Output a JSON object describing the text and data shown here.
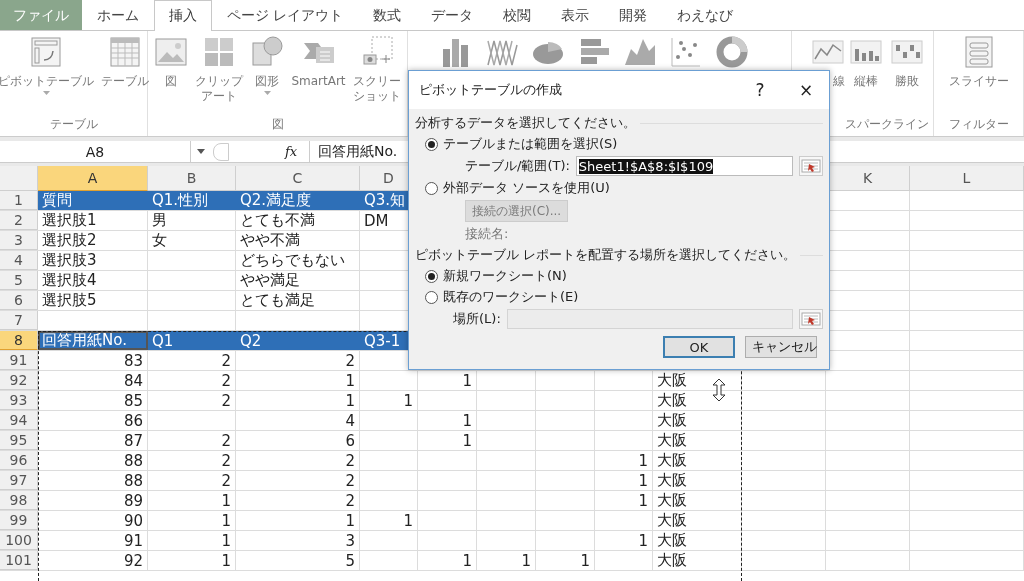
{
  "ribbon_tabs": [
    {
      "label": "ファイル",
      "kind": "file",
      "selected": false
    },
    {
      "label": "ホーム",
      "kind": "tab",
      "selected": false
    },
    {
      "label": "挿入",
      "kind": "tab",
      "selected": true
    },
    {
      "label": "ページ レイアウト",
      "kind": "tab",
      "selected": false
    },
    {
      "label": "数式",
      "kind": "tab",
      "selected": false
    },
    {
      "label": "データ",
      "kind": "tab",
      "selected": false
    },
    {
      "label": "校閲",
      "kind": "tab",
      "selected": false
    },
    {
      "label": "表示",
      "kind": "tab",
      "selected": false
    },
    {
      "label": "開発",
      "kind": "tab",
      "selected": false
    },
    {
      "label": "わえなび",
      "kind": "tab",
      "selected": false
    }
  ],
  "ribbon_groups": [
    {
      "kind": "commands",
      "label": "テーブル",
      "commands": [
        {
          "label": [
            "ピボットテーブル"
          ],
          "dropdown": true
        },
        {
          "label": [
            "テーブル"
          ],
          "dropdown": false
        }
      ]
    },
    {
      "kind": "commands",
      "label": "図",
      "commands": [
        {
          "label": [
            "図"
          ],
          "dropdown": false
        },
        {
          "label": [
            "クリップ",
            "アート"
          ],
          "dropdown": false
        },
        {
          "label": [
            "図形"
          ],
          "dropdown": true
        },
        {
          "label": [
            "SmartArt"
          ],
          "dropdown": false
        },
        {
          "label": [
            "スクリー",
            "ショット"
          ],
          "dropdown": false
        }
      ]
    },
    {
      "kind": "charts"
    },
    {
      "kind": "commands",
      "label": "スパークライン",
      "commands": [
        {
          "label": [
            "線"
          ],
          "dropdown": false
        },
        {
          "label": [
            "縦棒"
          ],
          "dropdown": false
        },
        {
          "label": [
            "勝敗"
          ],
          "dropdown": false
        }
      ]
    },
    {
      "kind": "commands",
      "label": "フィルター",
      "commands": [
        {
          "label": [
            "スライサー"
          ],
          "dropdown": false
        }
      ]
    }
  ],
  "formula_bar": {
    "name_box": "A8",
    "function_label": "fx",
    "formula": "回答用紙No."
  },
  "sheet": {
    "columns": [
      {
        "label": "A",
        "selected": true,
        "kind": "number"
      },
      {
        "label": "B",
        "selected": false,
        "kind": "number"
      },
      {
        "label": "C",
        "selected": false,
        "kind": "number"
      },
      {
        "label": "D",
        "selected": false,
        "kind": "number"
      },
      {
        "kind": "number"
      },
      {
        "kind": "number"
      },
      {
        "kind": "number"
      },
      {
        "kind": "number"
      },
      {
        "kind": "text"
      },
      {
        "kind": "number"
      },
      {
        "label": "K",
        "selected": false,
        "kind": "number"
      },
      {
        "label": "L",
        "selected": false,
        "kind": "number"
      }
    ],
    "rows": [
      {
        "number": "1",
        "kind": "header",
        "selected": false,
        "cells": [
          "質問",
          "Q1.性別",
          "Q2.満足度",
          "Q3.知"
        ]
      },
      {
        "number": "2",
        "kind": "text",
        "selected": false,
        "cells": [
          "選択肢1",
          "男",
          "とても不満",
          "DM"
        ]
      },
      {
        "number": "3",
        "kind": "text",
        "selected": false,
        "cells": [
          "選択肢2",
          "女",
          "やや不満"
        ]
      },
      {
        "number": "4",
        "kind": "text",
        "selected": false,
        "cells": [
          "選択肢3",
          null,
          "どちらでもない"
        ]
      },
      {
        "number": "5",
        "kind": "text",
        "selected": false,
        "cells": [
          "選択肢4",
          null,
          "やや満足"
        ]
      },
      {
        "number": "6",
        "kind": "text",
        "selected": false,
        "cells": [
          "選択肢5",
          null,
          "とても満足"
        ]
      },
      {
        "number": "7",
        "kind": "text",
        "selected": false
      },
      {
        "number": "8",
        "kind": "header",
        "selected": true,
        "cells": [
          "回答用紙No.",
          "Q1",
          "Q2",
          "Q3-1"
        ]
      },
      {
        "number": "91",
        "kind": "data",
        "selected": false,
        "cells": [
          "83",
          "2",
          "2"
        ]
      },
      {
        "number": "92",
        "kind": "data",
        "selected": false,
        "cells": [
          "84",
          "2",
          "1",
          null,
          "1",
          null,
          null,
          null,
          "大阪"
        ]
      },
      {
        "number": "93",
        "kind": "data",
        "selected": false,
        "cells": [
          "85",
          "2",
          "1",
          "1",
          null,
          null,
          null,
          null,
          "大阪"
        ]
      },
      {
        "number": "94",
        "kind": "data",
        "selected": false,
        "cells": [
          "86",
          null,
          "4",
          null,
          "1",
          null,
          null,
          null,
          "大阪"
        ]
      },
      {
        "number": "95",
        "kind": "data",
        "selected": false,
        "cells": [
          "87",
          "2",
          "6",
          null,
          "1",
          null,
          null,
          null,
          "大阪"
        ]
      },
      {
        "number": "96",
        "kind": "data",
        "selected": false,
        "cells": [
          "88",
          "2",
          "2",
          null,
          null,
          null,
          null,
          "1",
          "大阪"
        ]
      },
      {
        "number": "97",
        "kind": "data",
        "selected": false,
        "cells": [
          "88",
          "2",
          "2",
          null,
          null,
          null,
          null,
          "1",
          "大阪"
        ]
      },
      {
        "number": "98",
        "kind": "data",
        "selected": false,
        "cells": [
          "89",
          "1",
          "2",
          null,
          null,
          null,
          null,
          "1",
          "大阪"
        ]
      },
      {
        "number": "99",
        "kind": "data",
        "selected": false,
        "cells": [
          "90",
          "1",
          "1",
          "1",
          null,
          null,
          null,
          null,
          "大阪"
        ]
      },
      {
        "number": "100",
        "kind": "data",
        "selected": false,
        "cells": [
          "91",
          "1",
          "3",
          null,
          null,
          null,
          null,
          "1",
          "大阪"
        ]
      },
      {
        "number": "101",
        "kind": "data",
        "selected": false,
        "cells": [
          "92",
          "1",
          "5",
          null,
          "1",
          "1",
          "1",
          null,
          "大阪"
        ]
      }
    ]
  },
  "dialog": {
    "title": "ピボットテーブルの作成",
    "help_glyph": "?",
    "close_glyph": "×",
    "source": {
      "heading": "分析するデータを選択してください。",
      "options": [
        {
          "label": "テーブルまたは範囲を選択(S)",
          "selected": true
        },
        {
          "label": "外部データ ソースを使用(U)",
          "selected": false
        }
      ],
      "range_label": "テーブル/範囲(T):",
      "range_value": "Sheet1!$A$8:$I$109",
      "range_value_selected": true,
      "connection_button": {
        "label": "接続の選択(C)...",
        "disabled": true
      },
      "connection_label": "接続名:"
    },
    "destination": {
      "heading": "ピボットテーブル レポートを配置する場所を選択してください。",
      "options": [
        {
          "label": "新規ワークシート(N)",
          "selected": true
        },
        {
          "label": "既存のワークシート(E)",
          "selected": false
        }
      ],
      "location_label": "場所(L):",
      "location_disabled": true
    },
    "buttons": [
      {
        "label": "OK",
        "focused": true
      },
      {
        "label": "キャンセル",
        "focused": false
      }
    ]
  }
}
